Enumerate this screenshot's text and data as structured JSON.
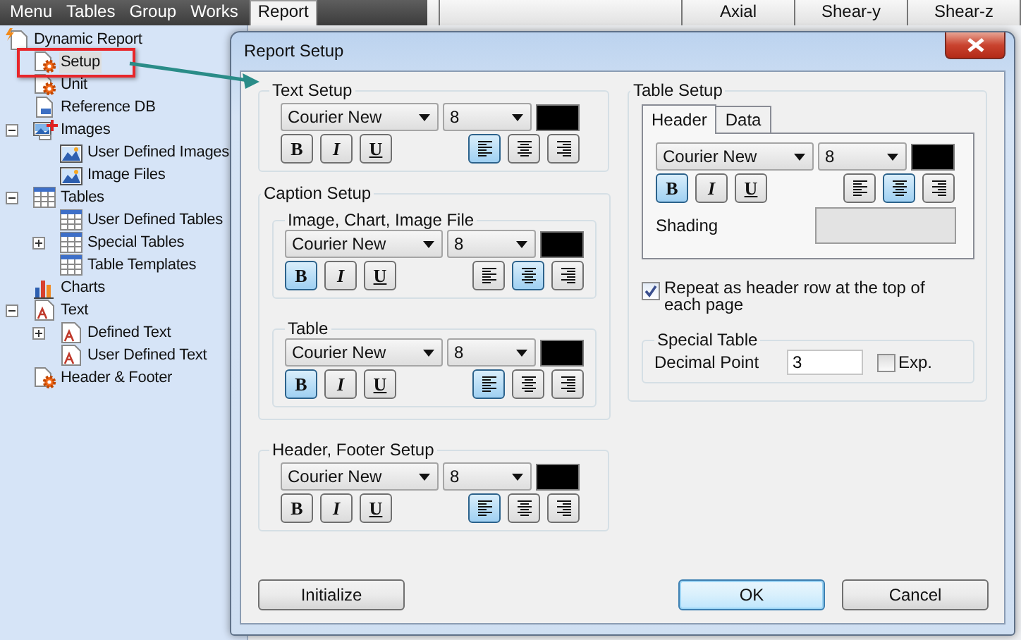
{
  "menu": [
    {
      "label": "Menu",
      "selected": false
    },
    {
      "label": "Tables",
      "selected": false
    },
    {
      "label": "Group",
      "selected": false
    },
    {
      "label": "Works",
      "selected": false
    },
    {
      "label": "Report",
      "selected": true
    }
  ],
  "grid_columns": [
    "Axial",
    "Shear-y",
    "Shear-z"
  ],
  "tree": [
    {
      "label": "Dynamic Report",
      "kind": "report",
      "selected": false,
      "children": [
        {
          "label": "Setup",
          "kind": "setup",
          "selected": true
        },
        {
          "label": "Unit",
          "kind": "setup",
          "selected": false
        },
        {
          "label": "Reference DB",
          "kind": "db",
          "selected": false
        },
        {
          "label": "Images",
          "kind": "images",
          "selected": false,
          "expanded": true,
          "children": [
            {
              "label": "User Defined Images",
              "kind": "image",
              "selected": false
            },
            {
              "label": "Image Files",
              "kind": "image",
              "selected": false
            }
          ]
        },
        {
          "label": "Tables",
          "kind": "tables",
          "selected": false,
          "expanded": true,
          "children": [
            {
              "label": "User Defined Tables",
              "kind": "table",
              "selected": false
            },
            {
              "label": "Special Tables",
              "kind": "table",
              "selected": false,
              "expanded": false
            },
            {
              "label": "Table Templates",
              "kind": "table",
              "selected": false
            }
          ]
        },
        {
          "label": "Charts",
          "kind": "chart",
          "selected": false
        },
        {
          "label": "Text",
          "kind": "text",
          "selected": false,
          "expanded": true,
          "children": [
            {
              "label": "Defined Text",
              "kind": "text",
              "selected": false,
              "expanded": false
            },
            {
              "label": "User Defined Text",
              "kind": "text",
              "selected": false
            }
          ]
        },
        {
          "label": "Header & Footer",
          "kind": "setup",
          "selected": false
        }
      ]
    }
  ],
  "dialog": {
    "title": "Report Setup",
    "text_setup": {
      "title": "Text Setup",
      "font": "Courier New",
      "size": "8",
      "color": "#000000",
      "styles": [
        {
          "label": "B",
          "pressed": false
        },
        {
          "label": "I",
          "pressed": false
        },
        {
          "label": "U",
          "pressed": false
        }
      ],
      "alignments": [
        {
          "kind": "left",
          "selected": true
        },
        {
          "kind": "center",
          "selected": false
        },
        {
          "kind": "right",
          "selected": false
        }
      ]
    },
    "caption_setup": {
      "title": "Caption Setup",
      "groups": [
        {
          "title": "Image, Chart, Image File",
          "font": "Courier New",
          "size": "8",
          "color": "#000000",
          "styles": [
            {
              "label": "B",
              "pressed": true
            },
            {
              "label": "I",
              "pressed": false
            },
            {
              "label": "U",
              "pressed": false
            }
          ],
          "alignments": [
            {
              "kind": "left",
              "selected": false
            },
            {
              "kind": "center",
              "selected": true
            },
            {
              "kind": "right",
              "selected": false
            }
          ]
        },
        {
          "title": "Table",
          "font": "Courier New",
          "size": "8",
          "color": "#000000",
          "styles": [
            {
              "label": "B",
              "pressed": true
            },
            {
              "label": "I",
              "pressed": false
            },
            {
              "label": "U",
              "pressed": false
            }
          ],
          "alignments": [
            {
              "kind": "left",
              "selected": true
            },
            {
              "kind": "center",
              "selected": false
            },
            {
              "kind": "right",
              "selected": false
            }
          ]
        }
      ]
    },
    "header_footer_setup": {
      "title": "Header, Footer Setup",
      "font": "Courier New",
      "size": "8",
      "color": "#000000",
      "styles": [
        {
          "label": "B",
          "pressed": false
        },
        {
          "label": "I",
          "pressed": false
        },
        {
          "label": "U",
          "pressed": false
        }
      ],
      "alignments": [
        {
          "kind": "left",
          "selected": true
        },
        {
          "kind": "center",
          "selected": false
        },
        {
          "kind": "right",
          "selected": false
        }
      ]
    },
    "table_setup": {
      "title": "Table Setup",
      "tabs": [
        {
          "label": "Header",
          "selected": true
        },
        {
          "label": "Data",
          "selected": false
        }
      ],
      "font_setup": {
        "font": "Courier New",
        "size": "8",
        "color": "#000000",
        "styles": [
          {
            "label": "B",
            "pressed": true
          },
          {
            "label": "I",
            "pressed": false
          },
          {
            "label": "U",
            "pressed": false
          }
        ],
        "alignments": [
          {
            "kind": "left",
            "selected": false
          },
          {
            "kind": "center",
            "selected": true
          },
          {
            "kind": "right",
            "selected": false
          }
        ]
      },
      "shading_label": "Shading",
      "repeat_header": {
        "label": "Repeat as header row at the top of each page",
        "checked": true
      },
      "special_table": {
        "title": "Special Table",
        "decimal_label": "Decimal Point",
        "decimal_value": "3",
        "exp": {
          "label": "Exp.",
          "checked": false
        }
      }
    },
    "initialize_button": "Initialize",
    "buttons": [
      {
        "label": "OK",
        "default": true
      },
      {
        "label": "Cancel",
        "default": false
      }
    ]
  }
}
